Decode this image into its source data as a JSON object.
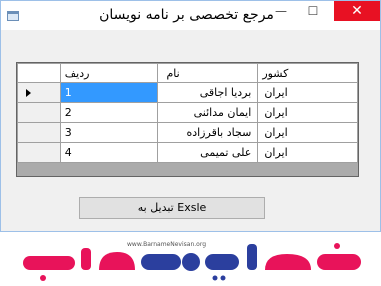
{
  "window": {
    "title": "مرجع تخصصی بر نامه نویسان",
    "close_glyph": "✕",
    "maximize_glyph": "☐",
    "minimize_glyph": "—"
  },
  "grid": {
    "columns": [
      "ردیف",
      "نام",
      "کشور"
    ],
    "rows": [
      {
        "id": "1",
        "name": "بردیا اجاقی",
        "country": "ایران",
        "current": true
      },
      {
        "id": "2",
        "name": "ایمان مدائنی",
        "country": "ایران",
        "current": false
      },
      {
        "id": "3",
        "name": "سجاد باقرزاده",
        "country": "ایران",
        "current": false
      },
      {
        "id": "4",
        "name": "علی تمیمی",
        "country": "ایران",
        "current": false
      }
    ],
    "selection_color": "#3399ff"
  },
  "convert_button": {
    "label": "تبدیل به Exsle"
  },
  "logo": {
    "url_text": "www.BarnameNevisan.org",
    "brand_color_primary": "#e8135a",
    "brand_color_secondary": "#2b3f9e"
  }
}
